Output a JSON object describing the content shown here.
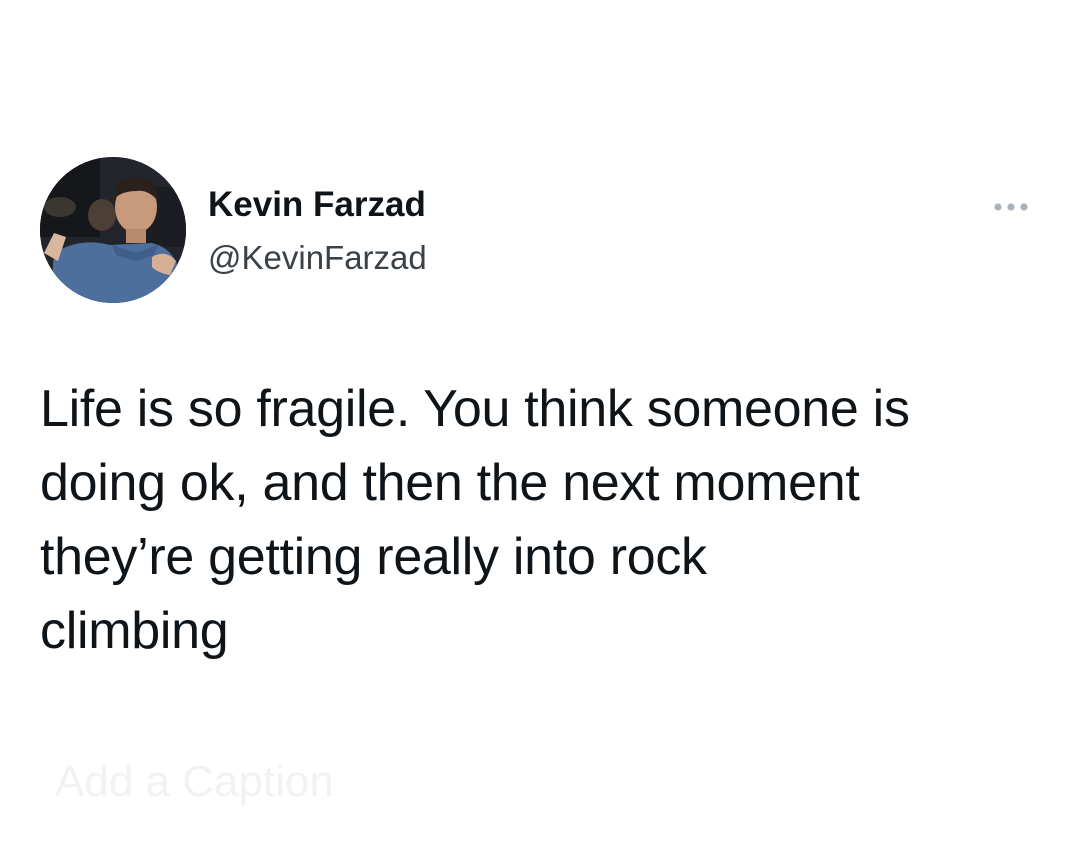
{
  "tweet": {
    "author": {
      "display_name": "Kevin Farzad",
      "handle": "@KevinFarzad"
    },
    "text_lines": [
      "Life is so fragile. You think someone is",
      "doing ok, and then the next moment",
      "they’re getting really into rock",
      "climbing"
    ],
    "faded_caption": "Add a Caption"
  },
  "icons": {
    "avatar": "profile-photo",
    "more": "more-horizontal-icon"
  },
  "colors": {
    "text": "#0f1419",
    "secondary_text": "#3b4148",
    "more_icon": "#aab3bb",
    "background": "#ffffff"
  }
}
